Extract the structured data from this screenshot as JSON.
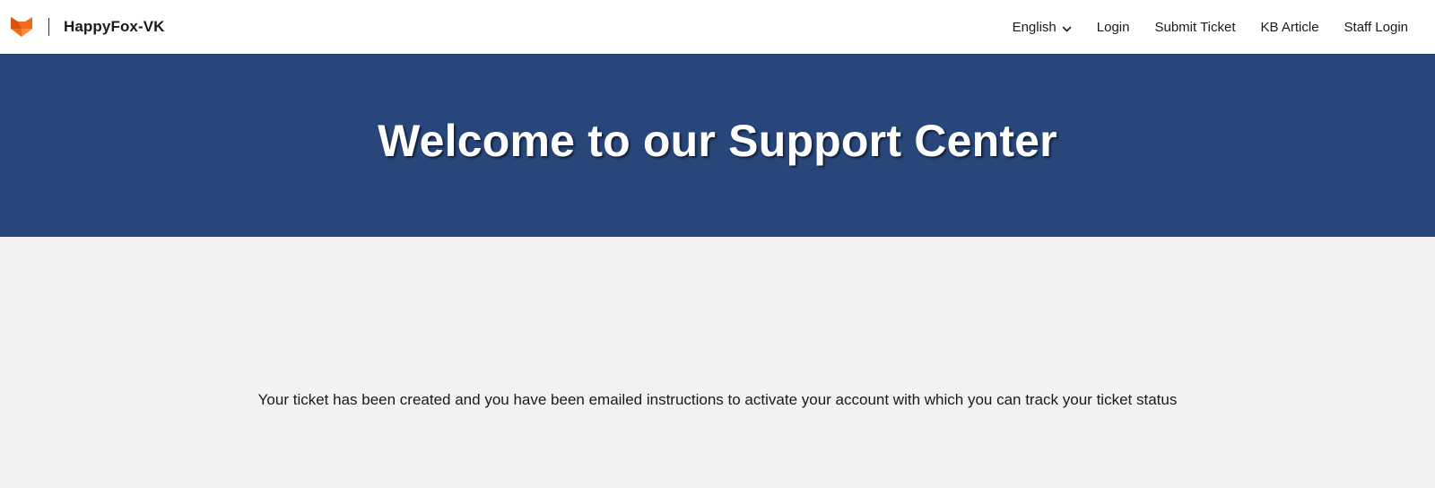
{
  "header": {
    "brand_name": "HappyFox-VK",
    "logo_icon": "fox-logo-icon",
    "brand_color": "#f26b1d",
    "language": {
      "selected": "English",
      "icon": "chevron-down-icon"
    },
    "nav": {
      "login": "Login",
      "submit_ticket": "Submit Ticket",
      "kb_article": "KB Article",
      "staff_login": "Staff Login"
    }
  },
  "hero": {
    "title": "Welcome to our Support Center",
    "background_color": "#28467a"
  },
  "main": {
    "message": "Your ticket has been created and you have been emailed instructions to activate your account with which you can track your ticket status",
    "background_color": "#f2f2f2"
  }
}
